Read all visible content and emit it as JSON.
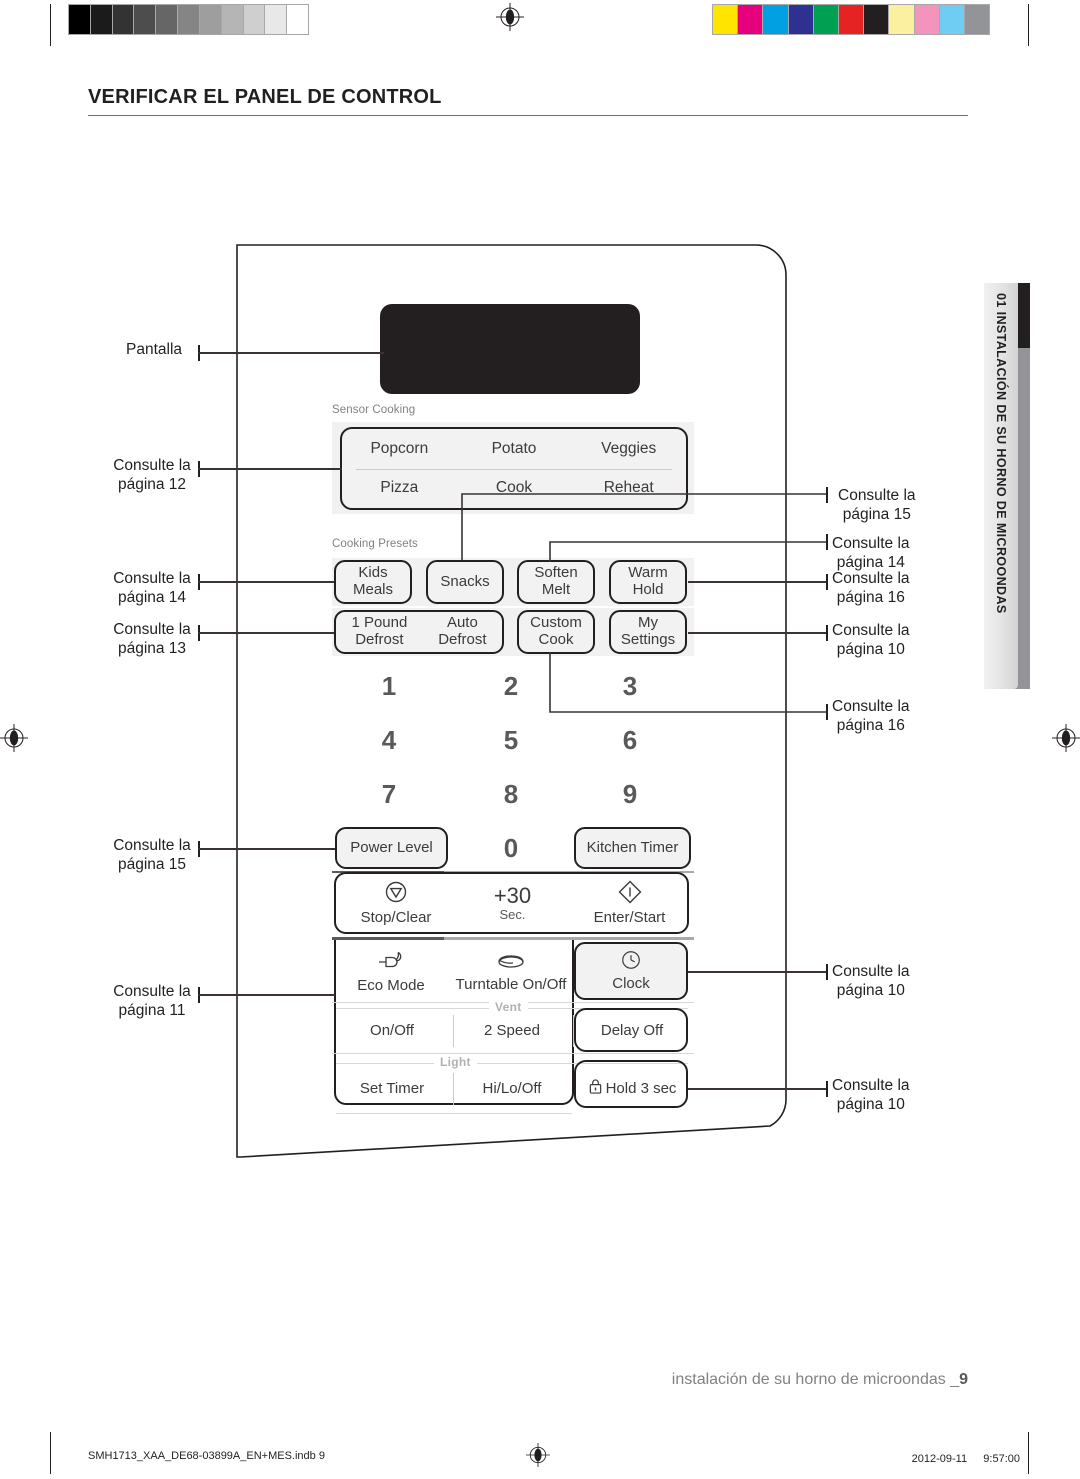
{
  "page": {
    "title": "VERIFICAR EL PANEL DE CONTROL",
    "side_tab": "01 INSTALACIÓN DE SU HORNO DE MICROONDAS",
    "running_footer_text": "instalación de su horno de microondas _",
    "running_footer_page": "9",
    "footer_left": "SMH1713_XAA_DE68-03899A_EN+MES.indb   9",
    "footer_right": "2012-09-11   ᅟ 9:57:00"
  },
  "colors": {
    "ink": "#231f20",
    "grey_rule": "#6d6e71",
    "panel_band": "#f1f1f2",
    "key_face": "#f2f2f2",
    "label_grey": "#808285",
    "display": "#231f20",
    "tab_dark": "#231f20",
    "tab_grey": "#929497"
  },
  "calibration": {
    "greyscale": [
      "#000000",
      "#1b1b1b",
      "#333333",
      "#4d4d4d",
      "#666666",
      "#858585",
      "#9e9e9e",
      "#b5b5b5",
      "#cfcfcf",
      "#e8e8e8",
      "#ffffff"
    ],
    "color": [
      "#ffe400",
      "#e6007e",
      "#00a0e3",
      "#2e3191",
      "#00a052",
      "#e52322",
      "#231f20",
      "#fbf0a0",
      "#f394bd",
      "#6fcdf3",
      "#929497"
    ]
  },
  "panel": {
    "sensor_cooking": {
      "label": "Sensor Cooking",
      "row1": [
        "Popcorn",
        "Potato",
        "Veggies"
      ],
      "row2": [
        "Pizza",
        "Cook",
        "Reheat"
      ]
    },
    "cooking_presets": {
      "label": "Cooking Presets",
      "keys": [
        {
          "line1": "Kids",
          "line2": "Meals"
        },
        {
          "line1": "Snacks",
          "line2": ""
        },
        {
          "line1": "Soften",
          "line2": "Melt"
        },
        {
          "line1": "Warm",
          "line2": "Hold"
        },
        {
          "line1": "1 Pound",
          "line2": "Defrost"
        },
        {
          "line1": "Auto",
          "line2": "Defrost"
        },
        {
          "line1": "Custom",
          "line2": "Cook"
        },
        {
          "line1": "My",
          "line2": "Settings"
        }
      ]
    },
    "numpad": [
      "1",
      "2",
      "3",
      "4",
      "5",
      "6",
      "7",
      "8",
      "9",
      "0"
    ],
    "power_level": "Power Level",
    "kitchen_timer": "Kitchen Timer",
    "control_row": [
      {
        "label": "Stop/Clear",
        "sub": "",
        "icon": "stop-triangle-icon"
      },
      {
        "label": "+30",
        "sub": "Sec.",
        "icon": "none"
      },
      {
        "label": "Enter/Start",
        "sub": "",
        "icon": "start-diamond-icon"
      }
    ],
    "mode_row": [
      {
        "label": "Eco Mode",
        "icon": "eco-plug-icon"
      },
      {
        "label": "Turntable On/Off",
        "icon": "turntable-icon"
      },
      {
        "label": "Clock",
        "icon": "clock-icon"
      }
    ],
    "vent": {
      "label": "Vent",
      "items": [
        "On/Off",
        "2 Speed",
        "Delay Off"
      ]
    },
    "light": {
      "label": "Light",
      "items": [
        "Set Timer",
        "Hi/Lo/Off",
        "Hold 3 sec"
      ],
      "lock_icon": "lock-icon"
    }
  },
  "callouts": {
    "left": [
      {
        "id": "display",
        "text1": "Pantalla",
        "text2": ""
      },
      {
        "id": "sensor-cooking",
        "text1": "Consulte la",
        "text2": "página 12"
      },
      {
        "id": "kids-meals",
        "text1": "Consulte la",
        "text2": "página 14"
      },
      {
        "id": "one-pound-defrost",
        "text1": "Consulte la",
        "text2": "página 13"
      },
      {
        "id": "power-level",
        "text1": "Consulte la",
        "text2": "página 15"
      },
      {
        "id": "eco-mode",
        "text1": "Consulte la",
        "text2": "página 11"
      }
    ],
    "right": [
      {
        "id": "snacks",
        "text1": "Consulte la",
        "text2": "página 15"
      },
      {
        "id": "soften-melt",
        "text1": "Consulte la",
        "text2": "página 14"
      },
      {
        "id": "warm-hold",
        "text1": "Consulte la",
        "text2": "página 16"
      },
      {
        "id": "my-settings",
        "text1": "Consulte la",
        "text2": "página 10"
      },
      {
        "id": "custom-cook",
        "text1": "Consulte la",
        "text2": "página 16"
      },
      {
        "id": "clock",
        "text1": "Consulte la",
        "text2": "página 10"
      },
      {
        "id": "hold-3-sec",
        "text1": "Consulte la",
        "text2": "página 10"
      }
    ]
  }
}
